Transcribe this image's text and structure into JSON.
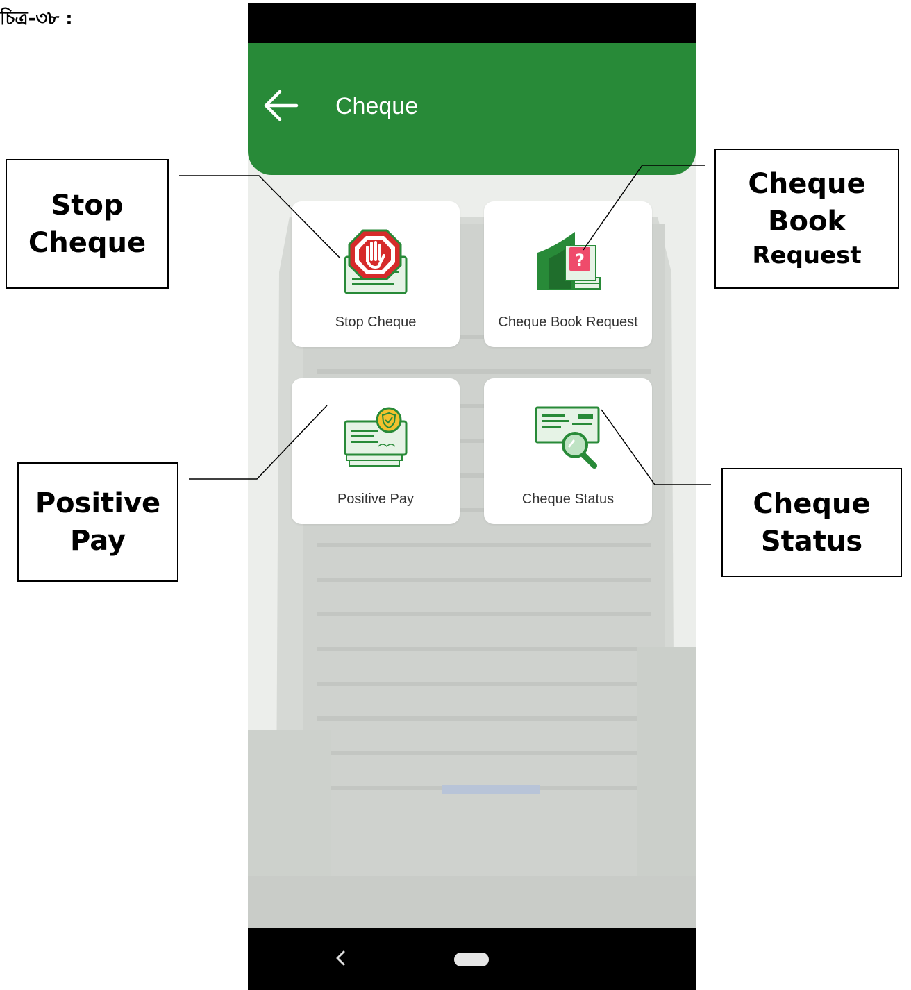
{
  "figure_caption": "চিত্র-৩৮ :",
  "app": {
    "title": "Cheque",
    "back_icon": "arrow-left-icon",
    "colors": {
      "primary": "#288a38",
      "stop_red": "#d62b2b",
      "question_pink": "#ef4b6b",
      "badge_yellow": "#f2c12e"
    }
  },
  "tiles": [
    {
      "label": "Stop Cheque",
      "icon": "stop-hand-cheque-icon"
    },
    {
      "label": "Cheque Book Request",
      "icon": "cheque-book-question-icon"
    },
    {
      "label": "Positive Pay",
      "icon": "cheque-shield-icon"
    },
    {
      "label": "Cheque Status",
      "icon": "cheque-magnifier-icon"
    }
  ],
  "callouts": {
    "stop_cheque": [
      "Stop",
      "Cheque"
    ],
    "cheque_book_request": [
      "Cheque",
      "Book",
      "Request"
    ],
    "positive_pay": [
      "Positive",
      "Pay"
    ],
    "cheque_status": [
      "Cheque",
      "Status"
    ]
  },
  "system_nav": {
    "back_icon": "chevron-left-icon",
    "home_icon": "home-pill-icon"
  }
}
